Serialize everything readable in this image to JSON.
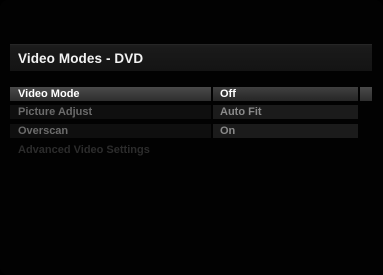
{
  "menu": {
    "title": "Video Modes - DVD",
    "items": [
      {
        "label": "Video Mode",
        "value": "Off"
      },
      {
        "label": "Picture Adjust",
        "value": "Auto Fit"
      },
      {
        "label": "Overscan",
        "value": "On"
      },
      {
        "label": "Advanced Video Settings"
      }
    ]
  },
  "colors": {
    "background": "#000000",
    "selected_text": "#ffffff",
    "normal_text": "#6b6b6b",
    "disabled_text": "#2c2c2c"
  }
}
